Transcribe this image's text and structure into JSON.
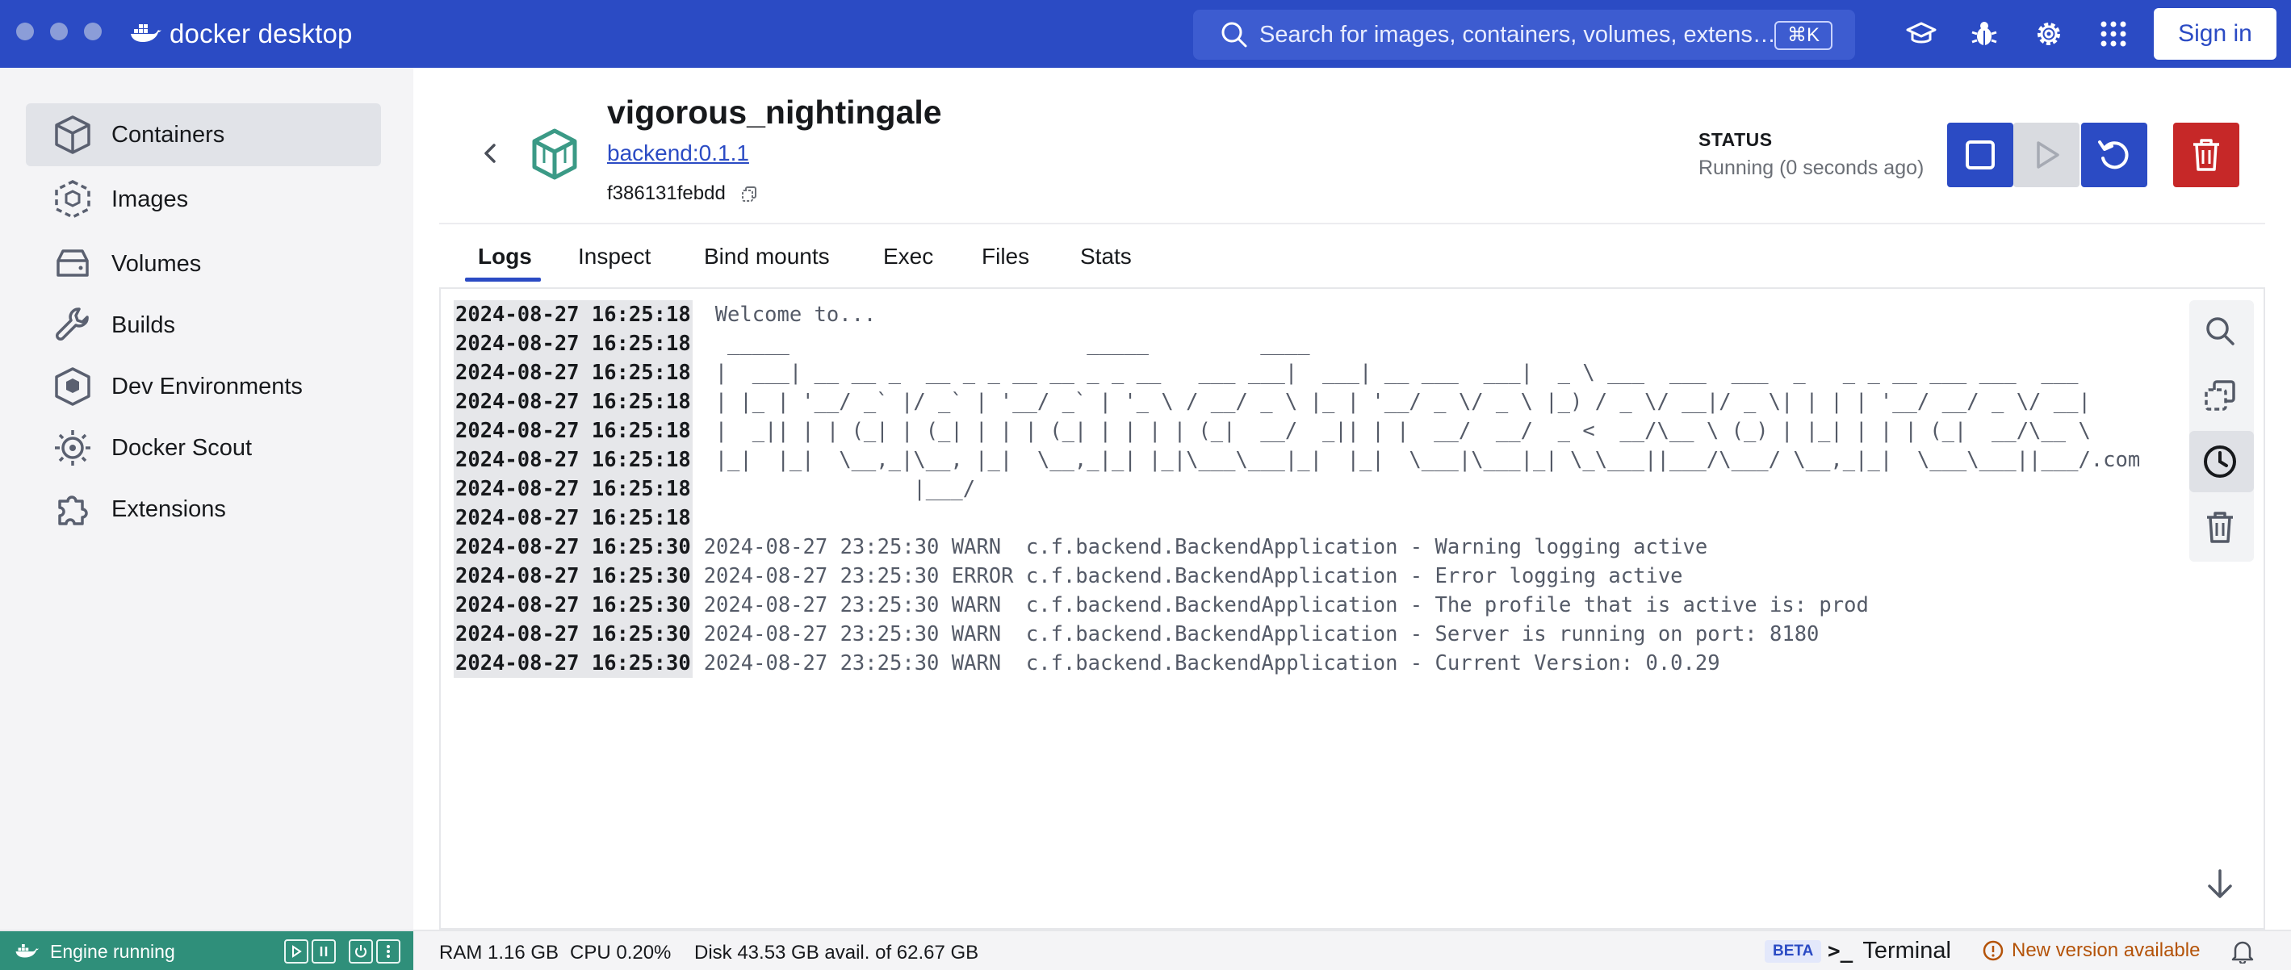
{
  "app": {
    "brand": "docker desktop",
    "search_placeholder": "Search for images, containers, volumes, extensi…",
    "search_shortcut": "⌘K",
    "sign_in": "Sign in"
  },
  "sidebar": {
    "items": [
      {
        "label": "Containers",
        "icon": "containers-icon",
        "active": true
      },
      {
        "label": "Images",
        "icon": "images-icon"
      },
      {
        "label": "Volumes",
        "icon": "volumes-icon"
      },
      {
        "label": "Builds",
        "icon": "builds-icon"
      },
      {
        "label": "Dev Environments",
        "icon": "dev-environments-icon"
      },
      {
        "label": "Docker Scout",
        "icon": "docker-scout-icon"
      },
      {
        "label": "Extensions",
        "icon": "extensions-icon"
      }
    ]
  },
  "container": {
    "name": "vigorous_nightingale",
    "image": "backend:0.1.1",
    "id": "f386131febdd",
    "status_label": "STATUS",
    "status_value": "Running (0 seconds ago)"
  },
  "tabs": [
    {
      "label": "Logs",
      "active": true
    },
    {
      "label": "Inspect"
    },
    {
      "label": "Bind mounts"
    },
    {
      "label": "Exec"
    },
    {
      "label": "Files"
    },
    {
      "label": "Stats"
    }
  ],
  "logs": [
    {
      "ts": "2024-08-27 16:25:18",
      "msg": "Welcome to...",
      "plain": true
    },
    {
      "ts": "2024-08-27 16:25:18",
      "msg": " _____                        _____         ____",
      "plain": true
    },
    {
      "ts": "2024-08-27 16:25:18",
      "msg": "|  ___| __ __ _  __ _ _ __ __ _ _ __   ___ ___|  ___| __ ___  ___|  _ \\ ___  ___  ___  _   _ _ __ ___ ___  ___",
      "plain": true
    },
    {
      "ts": "2024-08-27 16:25:18",
      "msg": "| |_ | '__/ _` |/ _` | '__/ _` | '_ \\ / __/ _ \\ |_ | '__/ _ \\/ _ \\ |_) / _ \\/ __|/ _ \\| | | | '__/ __/ _ \\/ __|",
      "plain": true
    },
    {
      "ts": "2024-08-27 16:25:18",
      "msg": "|  _|| | | (_| | (_| | | | (_| | | | | (_|  __/  _|| | |  __/  __/  _ <  __/\\__ \\ (_) | |_| | | | (_|  __/\\__ \\",
      "plain": true
    },
    {
      "ts": "2024-08-27 16:25:18",
      "msg": "|_|  |_|  \\__,_|\\__, |_|  \\__,_|_| |_|\\___\\___|_|  |_|  \\___|\\___|_| \\_\\___||___/\\___/ \\__,_|_|  \\___\\___||___/.com",
      "plain": true
    },
    {
      "ts": "2024-08-27 16:25:18",
      "msg": "                |___/",
      "plain": true
    },
    {
      "ts": "2024-08-27 16:25:18",
      "msg": "",
      "plain": true
    },
    {
      "ts": "2024-08-27 16:25:30",
      "msg": "2024-08-27 23:25:30 WARN  c.f.backend.BackendApplication - Warning logging active"
    },
    {
      "ts": "2024-08-27 16:25:30",
      "msg": "2024-08-27 23:25:30 ERROR c.f.backend.BackendApplication - Error logging active"
    },
    {
      "ts": "2024-08-27 16:25:30",
      "msg": "2024-08-27 23:25:30 WARN  c.f.backend.BackendApplication - The profile that is active is: prod"
    },
    {
      "ts": "2024-08-27 16:25:30",
      "msg": "2024-08-27 23:25:30 WARN  c.f.backend.BackendApplication - Server is running on port: 8180"
    },
    {
      "ts": "2024-08-27 16:25:30",
      "msg": "2024-08-27 23:25:30 WARN  c.f.backend.BackendApplication - Current Version: 0.0.29"
    }
  ],
  "footer": {
    "engine": "Engine running",
    "ram": "RAM 1.16 GB",
    "cpu": "CPU 0.20%",
    "disk": "Disk 43.53 GB avail. of 62.67 GB",
    "beta": "BETA",
    "terminal_prompt": ">_",
    "terminal": "Terminal",
    "new_version": "New version available"
  },
  "colors": {
    "accent": "#2b4bc4",
    "danger": "#c62828",
    "engine": "#2f8f7a"
  }
}
